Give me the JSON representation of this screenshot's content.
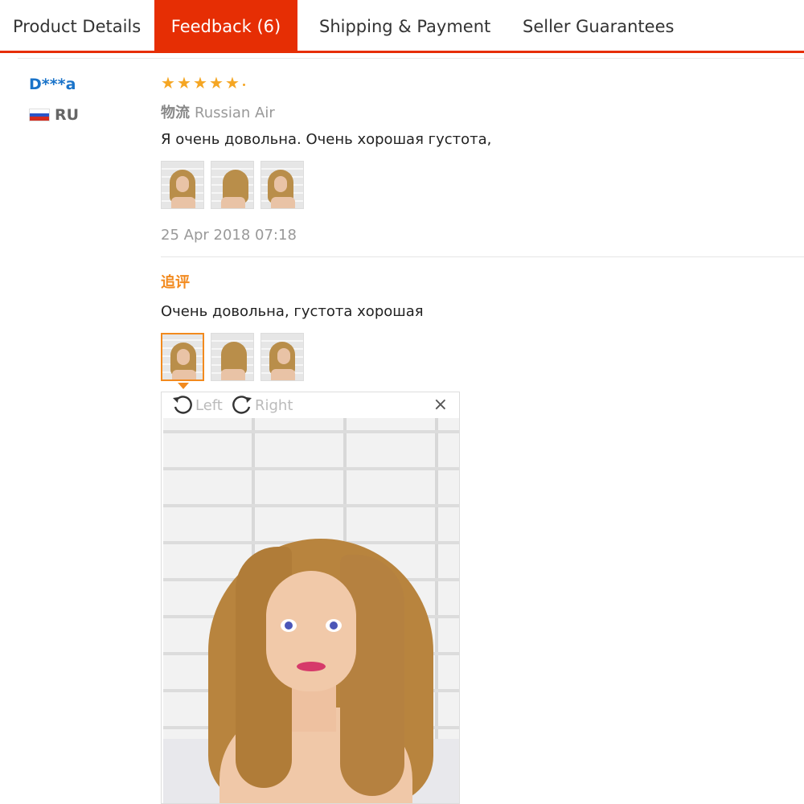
{
  "tabs": [
    {
      "label": "Product Details"
    },
    {
      "label": "Feedback (6)"
    },
    {
      "label": "Shipping & Payment"
    },
    {
      "label": "Seller Guarantees"
    }
  ],
  "active_tab_index": 1,
  "colors": {
    "accent": "#e62e04",
    "followup": "#f28a1e",
    "username": "#1a73c9",
    "stars": "#f5a623"
  },
  "review": {
    "user": {
      "name": "D***a",
      "country_code": "RU",
      "flag_icon": "russia-flag-icon"
    },
    "rating": 5,
    "logistics_label": "物流",
    "logistics_value": "Russian Air",
    "text": "Я очень довольна. Очень хорошая густота,",
    "photos_count": 3,
    "date": "25 Apr 2018 07:18",
    "followup": {
      "label": "追评",
      "text": "Очень довольна, густота хорошая",
      "photos_count": 3,
      "selected_photo_index": 0
    }
  },
  "viewer": {
    "rotate_left_label": "Left",
    "rotate_right_label": "Right",
    "close_icon": "close-icon",
    "rotate_left_icon": "rotate-left-icon",
    "rotate_right_icon": "rotate-right-icon"
  }
}
